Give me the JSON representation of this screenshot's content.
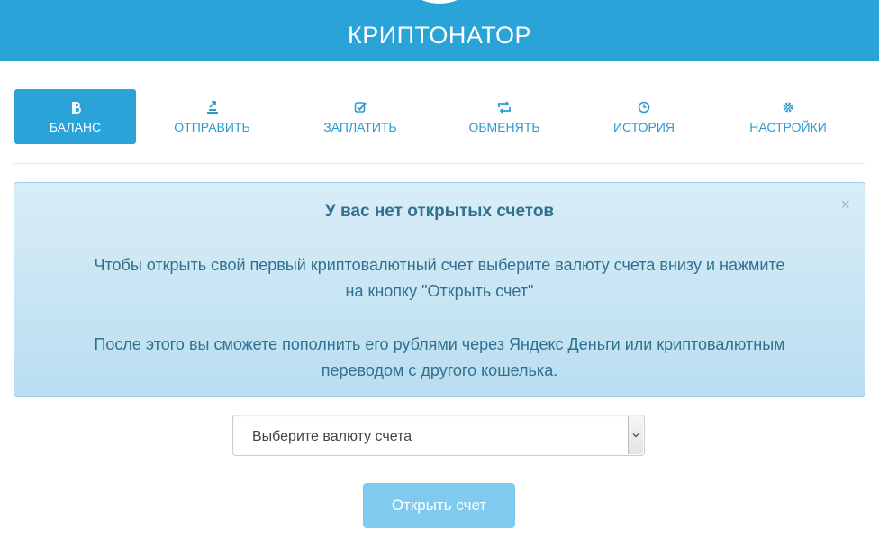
{
  "header": {
    "title": "КРИПТОНАТОР"
  },
  "tabs": [
    {
      "label": "БАЛАНС",
      "icon": "bitcoin-icon",
      "active": true
    },
    {
      "label": "ОТПРАВИТЬ",
      "icon": "send-icon",
      "active": false
    },
    {
      "label": "ЗАПЛАТИТЬ",
      "icon": "checkbox-icon",
      "active": false
    },
    {
      "label": "ОБМЕНЯТЬ",
      "icon": "exchange-icon",
      "active": false
    },
    {
      "label": "ИСТОРИЯ",
      "icon": "clock-icon",
      "active": false
    },
    {
      "label": "НАСТРОЙКИ",
      "icon": "gear-icon",
      "active": false
    }
  ],
  "alert": {
    "title": "У вас нет открытых счетов",
    "paragraph1_line1": "Чтобы открыть свой первый криптовалютный счет выберите валюту счета внизу и нажмите",
    "paragraph1_line2": "на кнопку \"Открыть счет\"",
    "paragraph2_line1": "После этого вы сможете пополнить его рублями через Яндекс Деньги или криптовалютным",
    "paragraph2_line2": "переводом с другого кошелька.",
    "close_glyph": "×"
  },
  "currency_select": {
    "value": "Выберите валюту счета"
  },
  "open_button": {
    "label": "Открыть счет"
  },
  "colors": {
    "brand": "#2aa3d8",
    "alert_text": "#31708f",
    "button_disabled": "#7fcaee"
  }
}
